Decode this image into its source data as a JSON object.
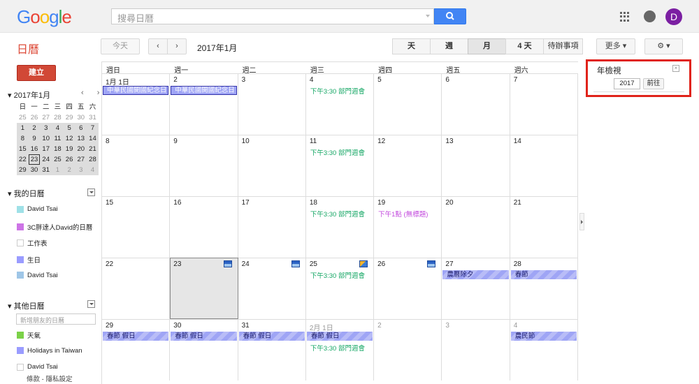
{
  "header": {
    "logo_letters": [
      {
        "ch": "G",
        "color": "#4285f4"
      },
      {
        "ch": "o",
        "color": "#ea4335"
      },
      {
        "ch": "o",
        "color": "#fbbc05"
      },
      {
        "ch": "g",
        "color": "#4285f4"
      },
      {
        "ch": "l",
        "color": "#34a853"
      },
      {
        "ch": "e",
        "color": "#ea4335"
      }
    ],
    "search_placeholder": "搜尋日曆",
    "avatar_letter": "D",
    "app_name": "日曆"
  },
  "toolbar": {
    "today": "今天",
    "prev": "‹",
    "next": "›",
    "range": "2017年1月",
    "views": [
      {
        "label": "天",
        "selected": false
      },
      {
        "label": "週",
        "selected": false
      },
      {
        "label": "月",
        "selected": true
      },
      {
        "label": "4 天",
        "selected": false
      },
      {
        "label": "待辦事項",
        "selected": false
      }
    ],
    "more": "更多 ▾",
    "settings": "⚙ ▾"
  },
  "sidebar": {
    "create": "建立",
    "mini_title": "▾ 2017年1月",
    "mini_nav": "‹ ›",
    "mini_weekdays": [
      "日",
      "一",
      "二",
      "三",
      "四",
      "五",
      "六"
    ],
    "mini_weeks": [
      [
        25,
        26,
        27,
        28,
        29,
        30,
        31
      ],
      [
        1,
        2,
        3,
        4,
        5,
        6,
        7
      ],
      [
        8,
        9,
        10,
        11,
        12,
        13,
        14
      ],
      [
        15,
        16,
        17,
        18,
        19,
        20,
        21
      ],
      [
        22,
        23,
        24,
        25,
        26,
        27,
        28
      ],
      [
        29,
        30,
        31,
        1,
        2,
        3,
        4
      ]
    ],
    "my_cal_title": "▾ 我的日曆",
    "my_calendars": [
      {
        "name": "David Tsai",
        "color": "#9fe1e7"
      },
      {
        "name": "3C胖達人David的日曆",
        "color": "#cd74e6"
      },
      {
        "name": "工作表",
        "color": "#ffffff"
      },
      {
        "name": "生日",
        "color": "#9a9cff"
      },
      {
        "name": "David Tsai",
        "color": "#9fc6e7"
      }
    ],
    "other_cal_title": "▾ 其他日曆",
    "add_friend_placeholder": "新增朋友的日曆",
    "other_calendars": [
      {
        "name": "天氣",
        "color": "#7bd148"
      },
      {
        "name": "Holidays in Taiwan",
        "color": "#9a9cff"
      },
      {
        "name": "David Tsai",
        "color": "#ffffff"
      }
    ],
    "footer": "條款 - 隱私設定"
  },
  "calendar": {
    "weekdays": [
      "週日",
      "週一",
      "週二",
      "週三",
      "週四",
      "週五",
      "週六"
    ],
    "weeks": [
      [
        {
          "d": "1月 1日",
          "bar": "中華民國開國紀念日",
          "barsel": true
        },
        {
          "d": "2",
          "bar": "中華民國開國紀念日",
          "barsel": true
        },
        {
          "d": "3"
        },
        {
          "d": "4",
          "timed": "下午3:30 部門週會"
        },
        {
          "d": "5"
        },
        {
          "d": "6"
        },
        {
          "d": "7"
        }
      ],
      [
        {
          "d": "8"
        },
        {
          "d": "9"
        },
        {
          "d": "10"
        },
        {
          "d": "11",
          "timed": "下午3:30 部門週會"
        },
        {
          "d": "12"
        },
        {
          "d": "13"
        },
        {
          "d": "14"
        }
      ],
      [
        {
          "d": "15"
        },
        {
          "d": "16"
        },
        {
          "d": "17"
        },
        {
          "d": "18",
          "timed": "下午3:30 部門週會"
        },
        {
          "d": "19",
          "timed2": "下午1點 (無標題)"
        },
        {
          "d": "20"
        },
        {
          "d": "21"
        }
      ],
      [
        {
          "d": "22"
        },
        {
          "d": "23",
          "today": true,
          "weather": "cloud"
        },
        {
          "d": "24",
          "weather": "cloud"
        },
        {
          "d": "25",
          "weather": "sun",
          "timed": "下午3:30 部門週會"
        },
        {
          "d": "26",
          "weather": "cloud"
        },
        {
          "d": "27",
          "bar": "農曆除夕"
        },
        {
          "d": "28",
          "bar": "春節"
        }
      ],
      [
        {
          "d": "29",
          "bar": "春節 假日"
        },
        {
          "d": "30",
          "bar": "春節 假日"
        },
        {
          "d": "31",
          "bar": "春節 假日"
        },
        {
          "d": "2月 1日",
          "other": true,
          "bar": "春節 假日",
          "timed": "下午3:30 部門週會"
        },
        {
          "d": "2",
          "other": true
        },
        {
          "d": "3",
          "other": true
        },
        {
          "d": "4",
          "other": true,
          "bar": "農民節"
        }
      ]
    ]
  },
  "year_view": {
    "title": "年檢視",
    "close": "×",
    "year": "2017",
    "go": "前往"
  }
}
